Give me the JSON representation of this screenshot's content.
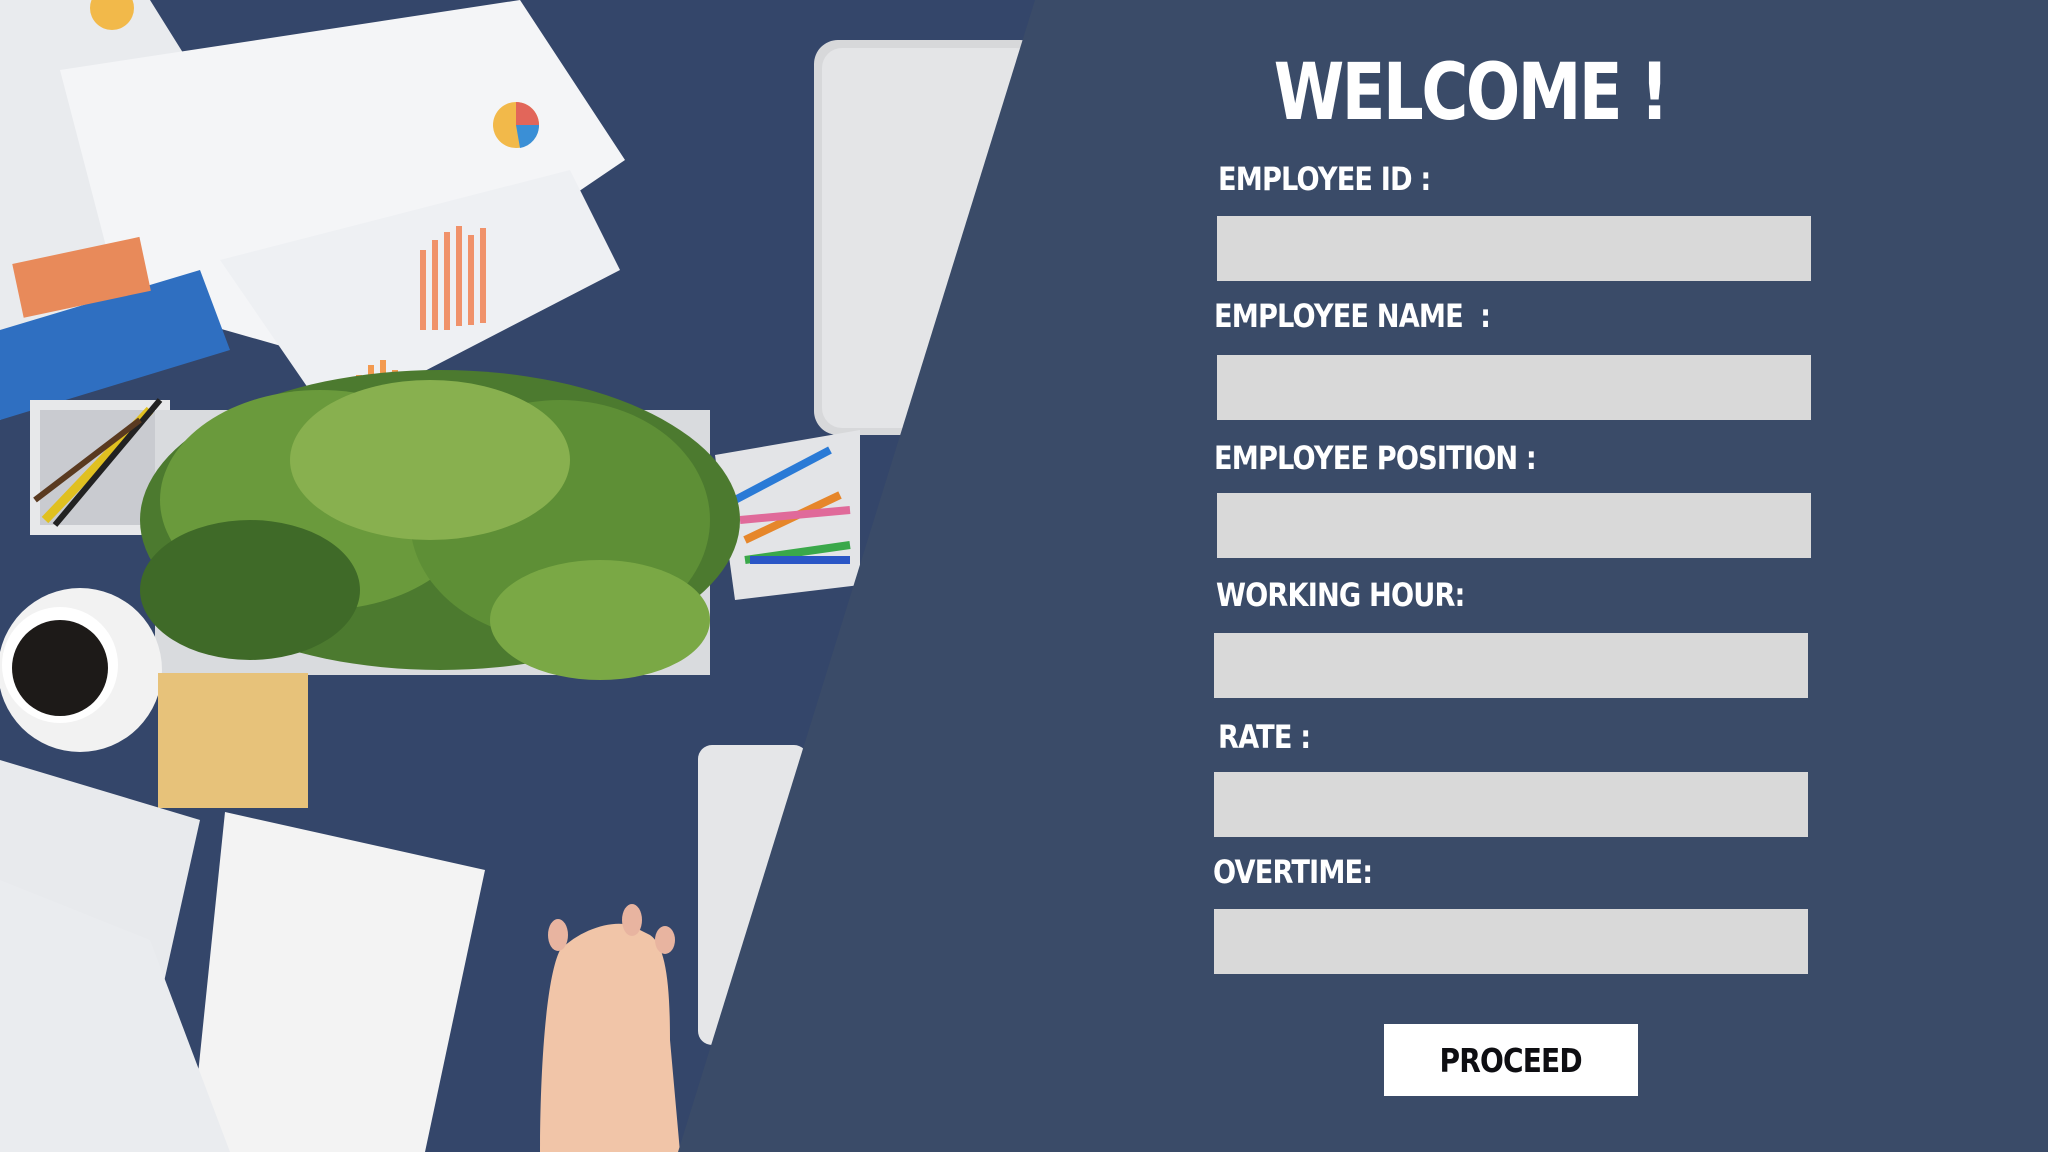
{
  "colors": {
    "panel": "#3a4b68",
    "field": "#d9d9d9",
    "button": "#ffffff",
    "desk": "#36476a"
  },
  "form": {
    "title": "WELCOME !",
    "fields": [
      {
        "label": "EMPLOYEE ID :",
        "value": ""
      },
      {
        "label": "EMPLOYEE NAME  :",
        "value": ""
      },
      {
        "label": "EMPLOYEE POSITION :",
        "value": ""
      },
      {
        "label": "WORKING HOUR:",
        "value": ""
      },
      {
        "label": "RATE :",
        "value": ""
      },
      {
        "label": "OVERTIME:",
        "value": ""
      }
    ],
    "proceed_label": "PROCEED"
  }
}
